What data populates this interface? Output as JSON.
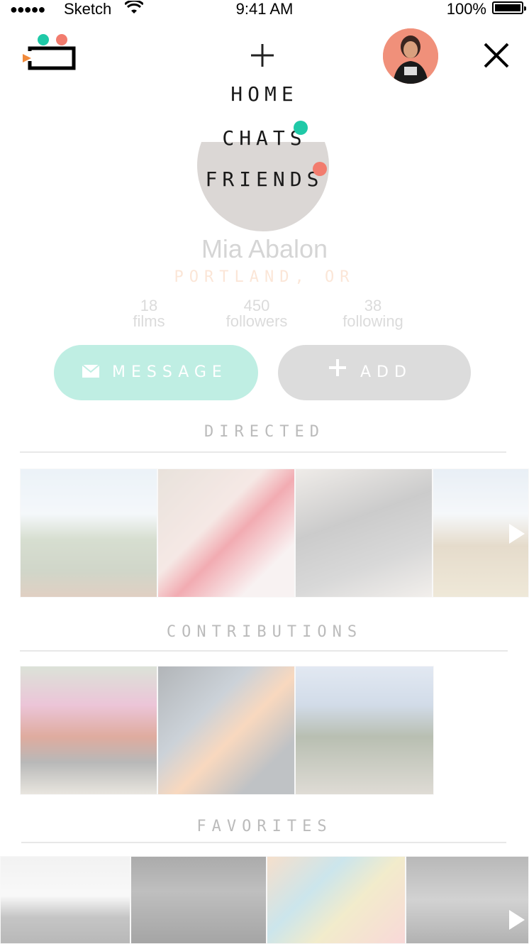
{
  "status_bar": {
    "signal_dots": "●●●●●",
    "carrier": "Sketch",
    "time": "9:41 AM",
    "battery": "100%"
  },
  "menu": [
    {
      "label": "HOME"
    },
    {
      "label": "CHATS",
      "badge_color": "#1fc9a7"
    },
    {
      "label": "FRIENDS",
      "badge_color": "#f27c6e"
    }
  ],
  "profile": {
    "name": "Mia Abalon",
    "location": "PORTLAND, OR",
    "stats": [
      {
        "value": "18",
        "label": "films"
      },
      {
        "value": "450",
        "label": "followers"
      },
      {
        "value": "38",
        "label": "following"
      }
    ],
    "message_button": "MESSAGE",
    "add_button": "ADD"
  },
  "sections": {
    "directed": "DIRECTED",
    "contributions": "CONTRIBUTIONS",
    "favorites": "FAVORITES"
  },
  "colors": {
    "accent_teal": "#1fc9a7",
    "accent_coral": "#f27c6e",
    "logo_orange": "#f08a3c"
  }
}
